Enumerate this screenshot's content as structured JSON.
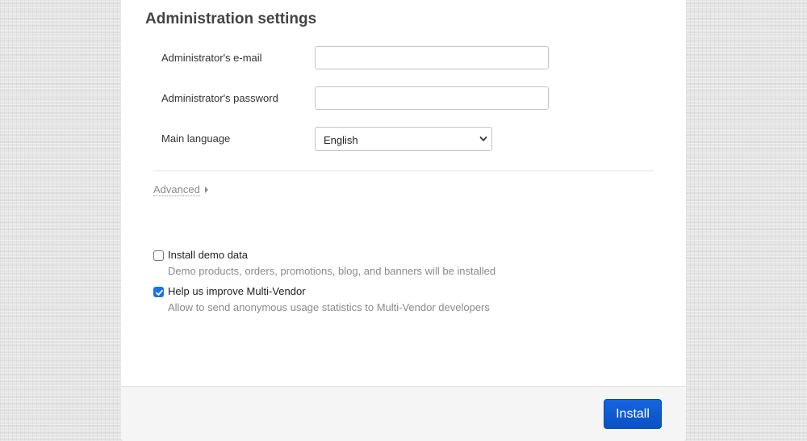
{
  "section": {
    "title": "Administration settings"
  },
  "fields": {
    "email": {
      "label": "Administrator's e-mail",
      "value": ""
    },
    "password": {
      "label": "Administrator's password",
      "value": ""
    },
    "language": {
      "label": "Main language",
      "selected": "English"
    }
  },
  "advanced": {
    "label": "Advanced",
    "icon": "caret-right-icon"
  },
  "options": [
    {
      "label": "Install demo data",
      "description": "Demo products, orders, promotions, blog, and banners will be installed",
      "checked": false
    },
    {
      "label": "Help us improve Multi-Vendor",
      "description": "Allow to send anonymous usage statistics to Multi-Vendor developers",
      "checked": true
    }
  ],
  "footer": {
    "install_label": "Install"
  },
  "colors": {
    "primary": "#0a50c4",
    "checkbox_accent": "#1a73e8",
    "muted_text": "#8a8a8a"
  }
}
